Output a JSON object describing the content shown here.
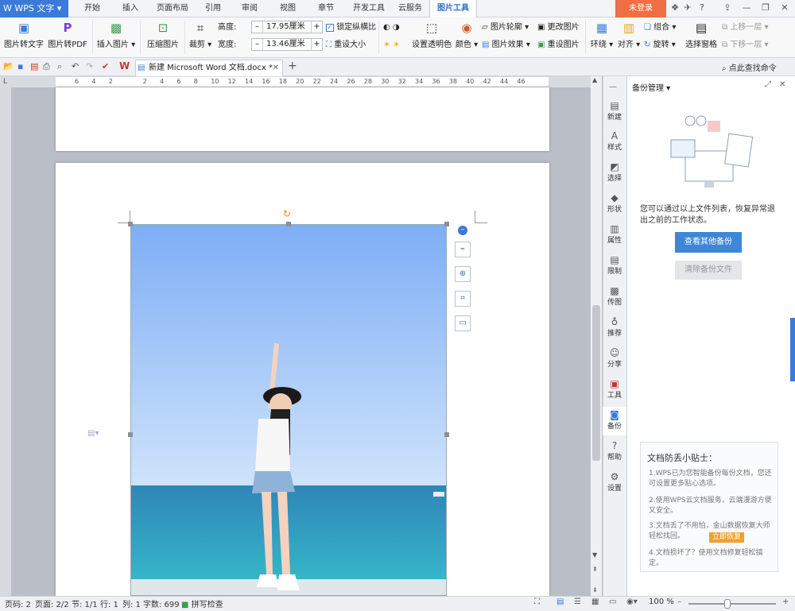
{
  "app": {
    "name": "WPS 文字"
  },
  "menu": [
    "开始",
    "插入",
    "页面布局",
    "引用",
    "审阅",
    "视图",
    "章节",
    "开发工具",
    "云服务",
    "图片工具"
  ],
  "login": "未登录",
  "ribbon": {
    "pic_to_text": "图片转文字",
    "pic_to_pdf": "图片转PDF",
    "insert_pic": "插入图片 ▾",
    "compress": "压缩图片",
    "crop": "裁剪 ▾",
    "height_label": "高度:",
    "height_value": "17.95厘米",
    "width_label": "宽度:",
    "width_value": "13.46厘米",
    "lock_ratio": "锁定纵横比",
    "reset_size": "重设大小",
    "transparent": "设置透明色",
    "color": "颜色 ▾",
    "outline": "图片轮廓 ▾",
    "effect": "图片效果 ▾",
    "change_pic": "更改图片",
    "reset_pic": "重设图片",
    "wrap": "环绕 ▾",
    "align": "对齐 ▾",
    "group": "组合 ▾",
    "rotate": "旋转 ▾",
    "selection_pane": "选择窗格",
    "bring_forward": "上移一层 ▾",
    "send_backward": "下移一层 ▾"
  },
  "tab": {
    "doc_title": "新建 Microsoft Word 文档.docx *",
    "search": "点此查找命令"
  },
  "ruler": {
    "numbers": [
      "6",
      "4",
      "2",
      "",
      "2",
      "4",
      "6",
      "8",
      "10",
      "12",
      "14",
      "16",
      "18",
      "20",
      "22",
      "24",
      "26",
      "28",
      "30",
      "32",
      "34",
      "36",
      "38",
      "40",
      "42",
      "44",
      "46"
    ]
  },
  "side": [
    "新建",
    "样式",
    "选择",
    "形状",
    "属性",
    "限制",
    "传图",
    "推荐",
    "分享",
    "工具",
    "备份",
    "帮助",
    "设置"
  ],
  "panel": {
    "title": "备份管理 ▾",
    "desc": "您可以通过以上文件列表，恢复异常退出之前的工作状态。",
    "btn_view": "查看其他备份",
    "btn_clear": "清除备份文件",
    "tips_title": "文档防丢小贴士：",
    "tip1": "1.WPS已为您智能备份每份文档，您还可设置更多贴心选项。",
    "tip2": "2.使用WPS云文档服务，云端漫游方便又安全。",
    "tip3": "3.文档丢了不用怕，金山数据恢复大师轻松找回。",
    "tip3_btn": "立即恢复",
    "tip4": "4.文档损坏了？使用文档修复轻松搞定。"
  },
  "status": {
    "page": "页码: 2",
    "pages": "页面: 2/2",
    "section": "节: 1/1",
    "row": "行: 1",
    "col": "列: 1",
    "words": "字数: 699",
    "spell": "拼写检查",
    "zoom": "100 %"
  },
  "colors": {
    "accent": "#3b7ad9",
    "login": "#ef6e44",
    "panel_btn": "#3f86d8"
  }
}
